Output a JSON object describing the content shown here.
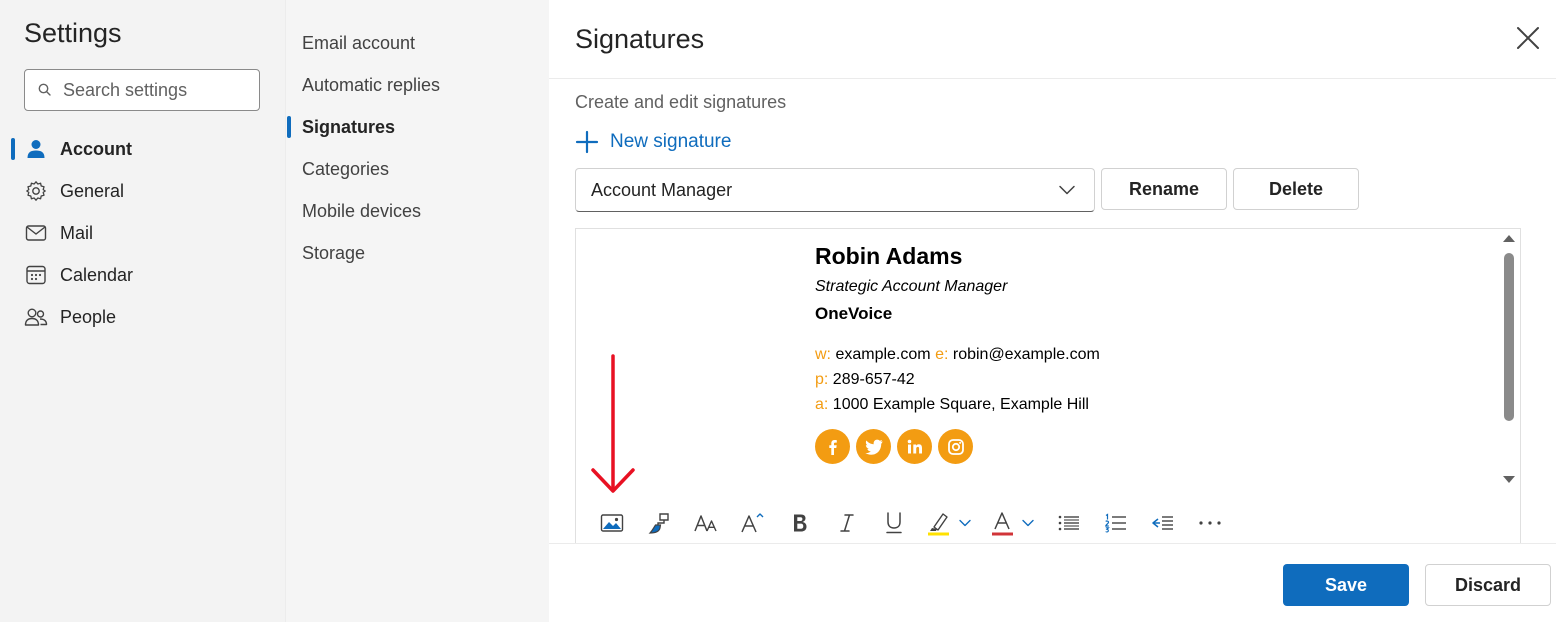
{
  "left_nav": {
    "title": "Settings",
    "search_placeholder": "Search settings",
    "items": [
      {
        "label": "Account",
        "icon": "person-icon",
        "active": true
      },
      {
        "label": "General",
        "icon": "gear-icon",
        "active": false
      },
      {
        "label": "Mail",
        "icon": "mail-icon",
        "active": false
      },
      {
        "label": "Calendar",
        "icon": "calendar-icon",
        "active": false
      },
      {
        "label": "People",
        "icon": "people-icon",
        "active": false
      }
    ]
  },
  "account_nav": {
    "items": [
      {
        "label": "Email account",
        "active": false
      },
      {
        "label": "Automatic replies",
        "active": false
      },
      {
        "label": "Signatures",
        "active": true
      },
      {
        "label": "Categories",
        "active": false
      },
      {
        "label": "Mobile devices",
        "active": false
      },
      {
        "label": "Storage",
        "active": false
      }
    ]
  },
  "content": {
    "title": "Signatures",
    "section_label": "Create and edit signatures",
    "new_signature_label": "New signature",
    "selected_signature": "Account Manager",
    "rename_label": "Rename",
    "delete_label": "Delete",
    "save_label": "Save",
    "discard_label": "Discard"
  },
  "signature": {
    "name": "Robin Adams",
    "role": "Strategic Account Manager",
    "company": "OneVoice",
    "web_label": "w:",
    "web": "example.com",
    "email_label": "e:",
    "email": "robin@example.com",
    "phone_label": "p:",
    "phone": "289-657-42",
    "address_label": "a:",
    "address": "1000 Example Square, Example Hill",
    "accent_color": "#f39c12",
    "social": [
      "facebook-icon",
      "twitter-icon",
      "linkedin-icon",
      "instagram-icon"
    ]
  },
  "toolbar": {
    "tools": [
      "insert-picture-icon",
      "format-painter-icon",
      "font-size-icon",
      "increase-font-icon",
      "bold-icon",
      "italic-icon",
      "underline-icon",
      "highlight-icon",
      "font-color-icon",
      "bullets-icon",
      "numbering-icon",
      "decrease-indent-icon",
      "more-icon"
    ]
  },
  "colors": {
    "brand": "#0f6cbd",
    "annotation_arrow": "#e81123"
  }
}
